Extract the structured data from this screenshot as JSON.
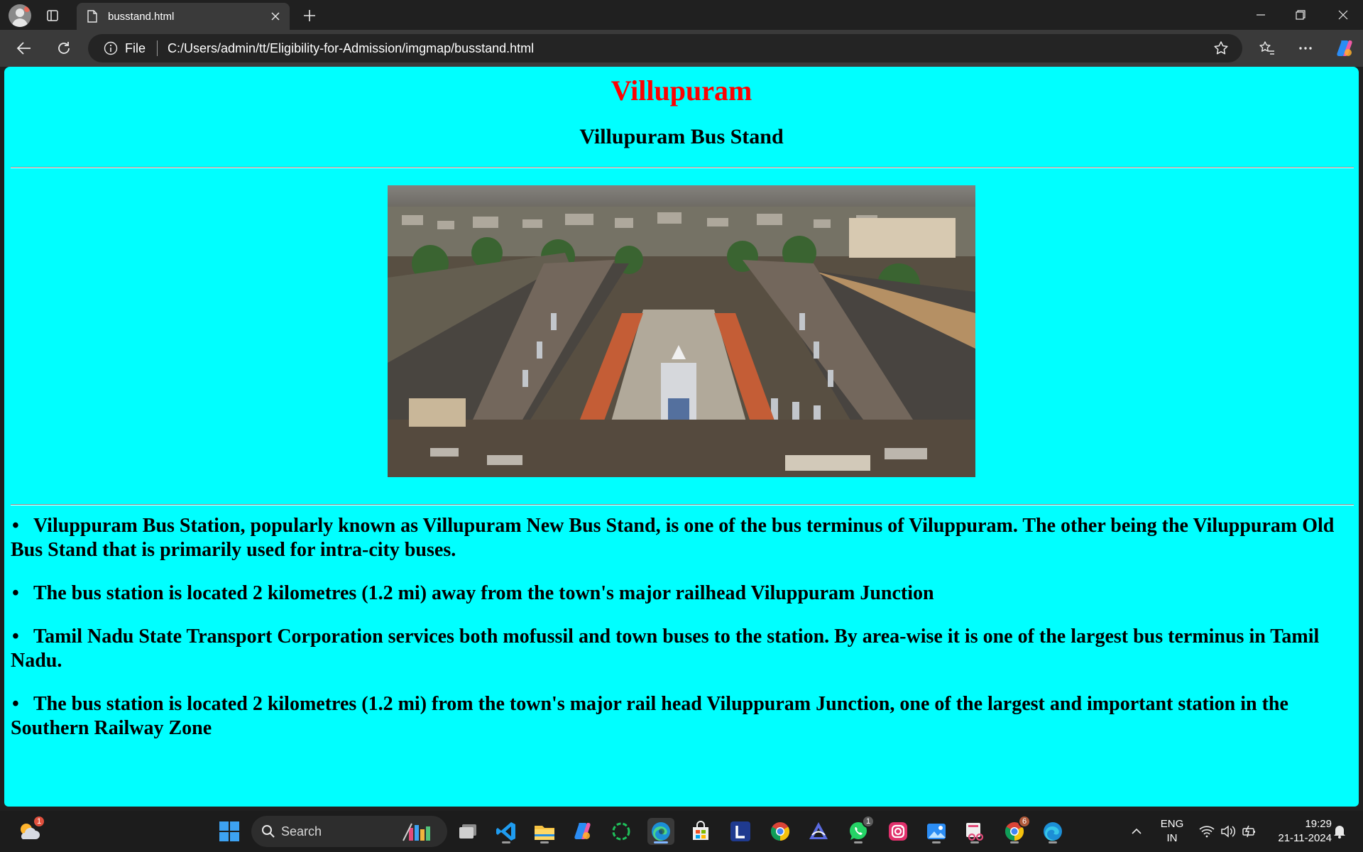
{
  "browser": {
    "tab_title": "busstand.html",
    "address_scheme_label": "File",
    "address_url": "C:/Users/admin/tt/Eligibility-for-Admission/imgmap/busstand.html"
  },
  "page": {
    "title": "Villupuram",
    "subtitle": "Villupuram Bus Stand",
    "background_color": "#00ffff",
    "title_color": "#ff0000",
    "image_alt": "Aerial view of Villupuram bus stand",
    "bullet_char": "•",
    "facts": [
      "Viluppuram Bus Station, popularly known as Villupuram New Bus Stand, is one of the bus terminus of Viluppuram. The other being the Viluppuram Old Bus Stand that is primarily used for intra-city buses.",
      "The bus station is located 2 kilometres (1.2 mi) away from the town's major railhead Viluppuram Junction",
      "Tamil Nadu State Transport Corporation services both mofussil and town buses to the station. By area-wise it is one of the largest bus terminus in Tamil Nadu.",
      "The bus station is located 2 kilometres (1.2 mi) from the town's major rail head Viluppuram Junction, one of the largest and important station in the Southern Railway Zone"
    ]
  },
  "taskbar": {
    "search_label": "Search",
    "weather_badge": "1",
    "whatsapp_badge": "1",
    "chrome_badge": "6",
    "language_top": "ENG",
    "language_bottom": "IN",
    "time": "19:29",
    "date": "21-11-2024",
    "icons": [
      "weather-icon",
      "windows-start-icon",
      "search-icon",
      "task-view-icon",
      "vscode-icon",
      "file-explorer-icon",
      "copilot-icon",
      "app-ring-icon",
      "edge-icon",
      "store-icon",
      "l-app-icon",
      "chrome-icon",
      "arc-app-icon",
      "whatsapp-icon",
      "instagram-icon",
      "photos-icon",
      "snipping-tool-icon",
      "chrome-profile-icon",
      "edge-dev-icon"
    ]
  }
}
